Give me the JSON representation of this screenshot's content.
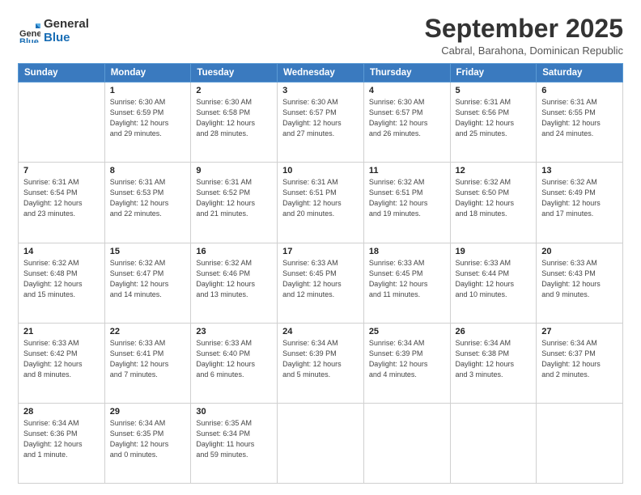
{
  "logo": {
    "general": "General",
    "blue": "Blue"
  },
  "header": {
    "month": "September 2025",
    "location": "Cabral, Barahona, Dominican Republic"
  },
  "weekdays": [
    "Sunday",
    "Monday",
    "Tuesday",
    "Wednesday",
    "Thursday",
    "Friday",
    "Saturday"
  ],
  "weeks": [
    [
      {
        "day": "",
        "info": ""
      },
      {
        "day": "1",
        "info": "Sunrise: 6:30 AM\nSunset: 6:59 PM\nDaylight: 12 hours\nand 29 minutes."
      },
      {
        "day": "2",
        "info": "Sunrise: 6:30 AM\nSunset: 6:58 PM\nDaylight: 12 hours\nand 28 minutes."
      },
      {
        "day": "3",
        "info": "Sunrise: 6:30 AM\nSunset: 6:57 PM\nDaylight: 12 hours\nand 27 minutes."
      },
      {
        "day": "4",
        "info": "Sunrise: 6:30 AM\nSunset: 6:57 PM\nDaylight: 12 hours\nand 26 minutes."
      },
      {
        "day": "5",
        "info": "Sunrise: 6:31 AM\nSunset: 6:56 PM\nDaylight: 12 hours\nand 25 minutes."
      },
      {
        "day": "6",
        "info": "Sunrise: 6:31 AM\nSunset: 6:55 PM\nDaylight: 12 hours\nand 24 minutes."
      }
    ],
    [
      {
        "day": "7",
        "info": "Sunrise: 6:31 AM\nSunset: 6:54 PM\nDaylight: 12 hours\nand 23 minutes."
      },
      {
        "day": "8",
        "info": "Sunrise: 6:31 AM\nSunset: 6:53 PM\nDaylight: 12 hours\nand 22 minutes."
      },
      {
        "day": "9",
        "info": "Sunrise: 6:31 AM\nSunset: 6:52 PM\nDaylight: 12 hours\nand 21 minutes."
      },
      {
        "day": "10",
        "info": "Sunrise: 6:31 AM\nSunset: 6:51 PM\nDaylight: 12 hours\nand 20 minutes."
      },
      {
        "day": "11",
        "info": "Sunrise: 6:32 AM\nSunset: 6:51 PM\nDaylight: 12 hours\nand 19 minutes."
      },
      {
        "day": "12",
        "info": "Sunrise: 6:32 AM\nSunset: 6:50 PM\nDaylight: 12 hours\nand 18 minutes."
      },
      {
        "day": "13",
        "info": "Sunrise: 6:32 AM\nSunset: 6:49 PM\nDaylight: 12 hours\nand 17 minutes."
      }
    ],
    [
      {
        "day": "14",
        "info": "Sunrise: 6:32 AM\nSunset: 6:48 PM\nDaylight: 12 hours\nand 15 minutes."
      },
      {
        "day": "15",
        "info": "Sunrise: 6:32 AM\nSunset: 6:47 PM\nDaylight: 12 hours\nand 14 minutes."
      },
      {
        "day": "16",
        "info": "Sunrise: 6:32 AM\nSunset: 6:46 PM\nDaylight: 12 hours\nand 13 minutes."
      },
      {
        "day": "17",
        "info": "Sunrise: 6:33 AM\nSunset: 6:45 PM\nDaylight: 12 hours\nand 12 minutes."
      },
      {
        "day": "18",
        "info": "Sunrise: 6:33 AM\nSunset: 6:45 PM\nDaylight: 12 hours\nand 11 minutes."
      },
      {
        "day": "19",
        "info": "Sunrise: 6:33 AM\nSunset: 6:44 PM\nDaylight: 12 hours\nand 10 minutes."
      },
      {
        "day": "20",
        "info": "Sunrise: 6:33 AM\nSunset: 6:43 PM\nDaylight: 12 hours\nand 9 minutes."
      }
    ],
    [
      {
        "day": "21",
        "info": "Sunrise: 6:33 AM\nSunset: 6:42 PM\nDaylight: 12 hours\nand 8 minutes."
      },
      {
        "day": "22",
        "info": "Sunrise: 6:33 AM\nSunset: 6:41 PM\nDaylight: 12 hours\nand 7 minutes."
      },
      {
        "day": "23",
        "info": "Sunrise: 6:33 AM\nSunset: 6:40 PM\nDaylight: 12 hours\nand 6 minutes."
      },
      {
        "day": "24",
        "info": "Sunrise: 6:34 AM\nSunset: 6:39 PM\nDaylight: 12 hours\nand 5 minutes."
      },
      {
        "day": "25",
        "info": "Sunrise: 6:34 AM\nSunset: 6:39 PM\nDaylight: 12 hours\nand 4 minutes."
      },
      {
        "day": "26",
        "info": "Sunrise: 6:34 AM\nSunset: 6:38 PM\nDaylight: 12 hours\nand 3 minutes."
      },
      {
        "day": "27",
        "info": "Sunrise: 6:34 AM\nSunset: 6:37 PM\nDaylight: 12 hours\nand 2 minutes."
      }
    ],
    [
      {
        "day": "28",
        "info": "Sunrise: 6:34 AM\nSunset: 6:36 PM\nDaylight: 12 hours\nand 1 minute."
      },
      {
        "day": "29",
        "info": "Sunrise: 6:34 AM\nSunset: 6:35 PM\nDaylight: 12 hours\nand 0 minutes."
      },
      {
        "day": "30",
        "info": "Sunrise: 6:35 AM\nSunset: 6:34 PM\nDaylight: 11 hours\nand 59 minutes."
      },
      {
        "day": "",
        "info": ""
      },
      {
        "day": "",
        "info": ""
      },
      {
        "day": "",
        "info": ""
      },
      {
        "day": "",
        "info": ""
      }
    ]
  ]
}
